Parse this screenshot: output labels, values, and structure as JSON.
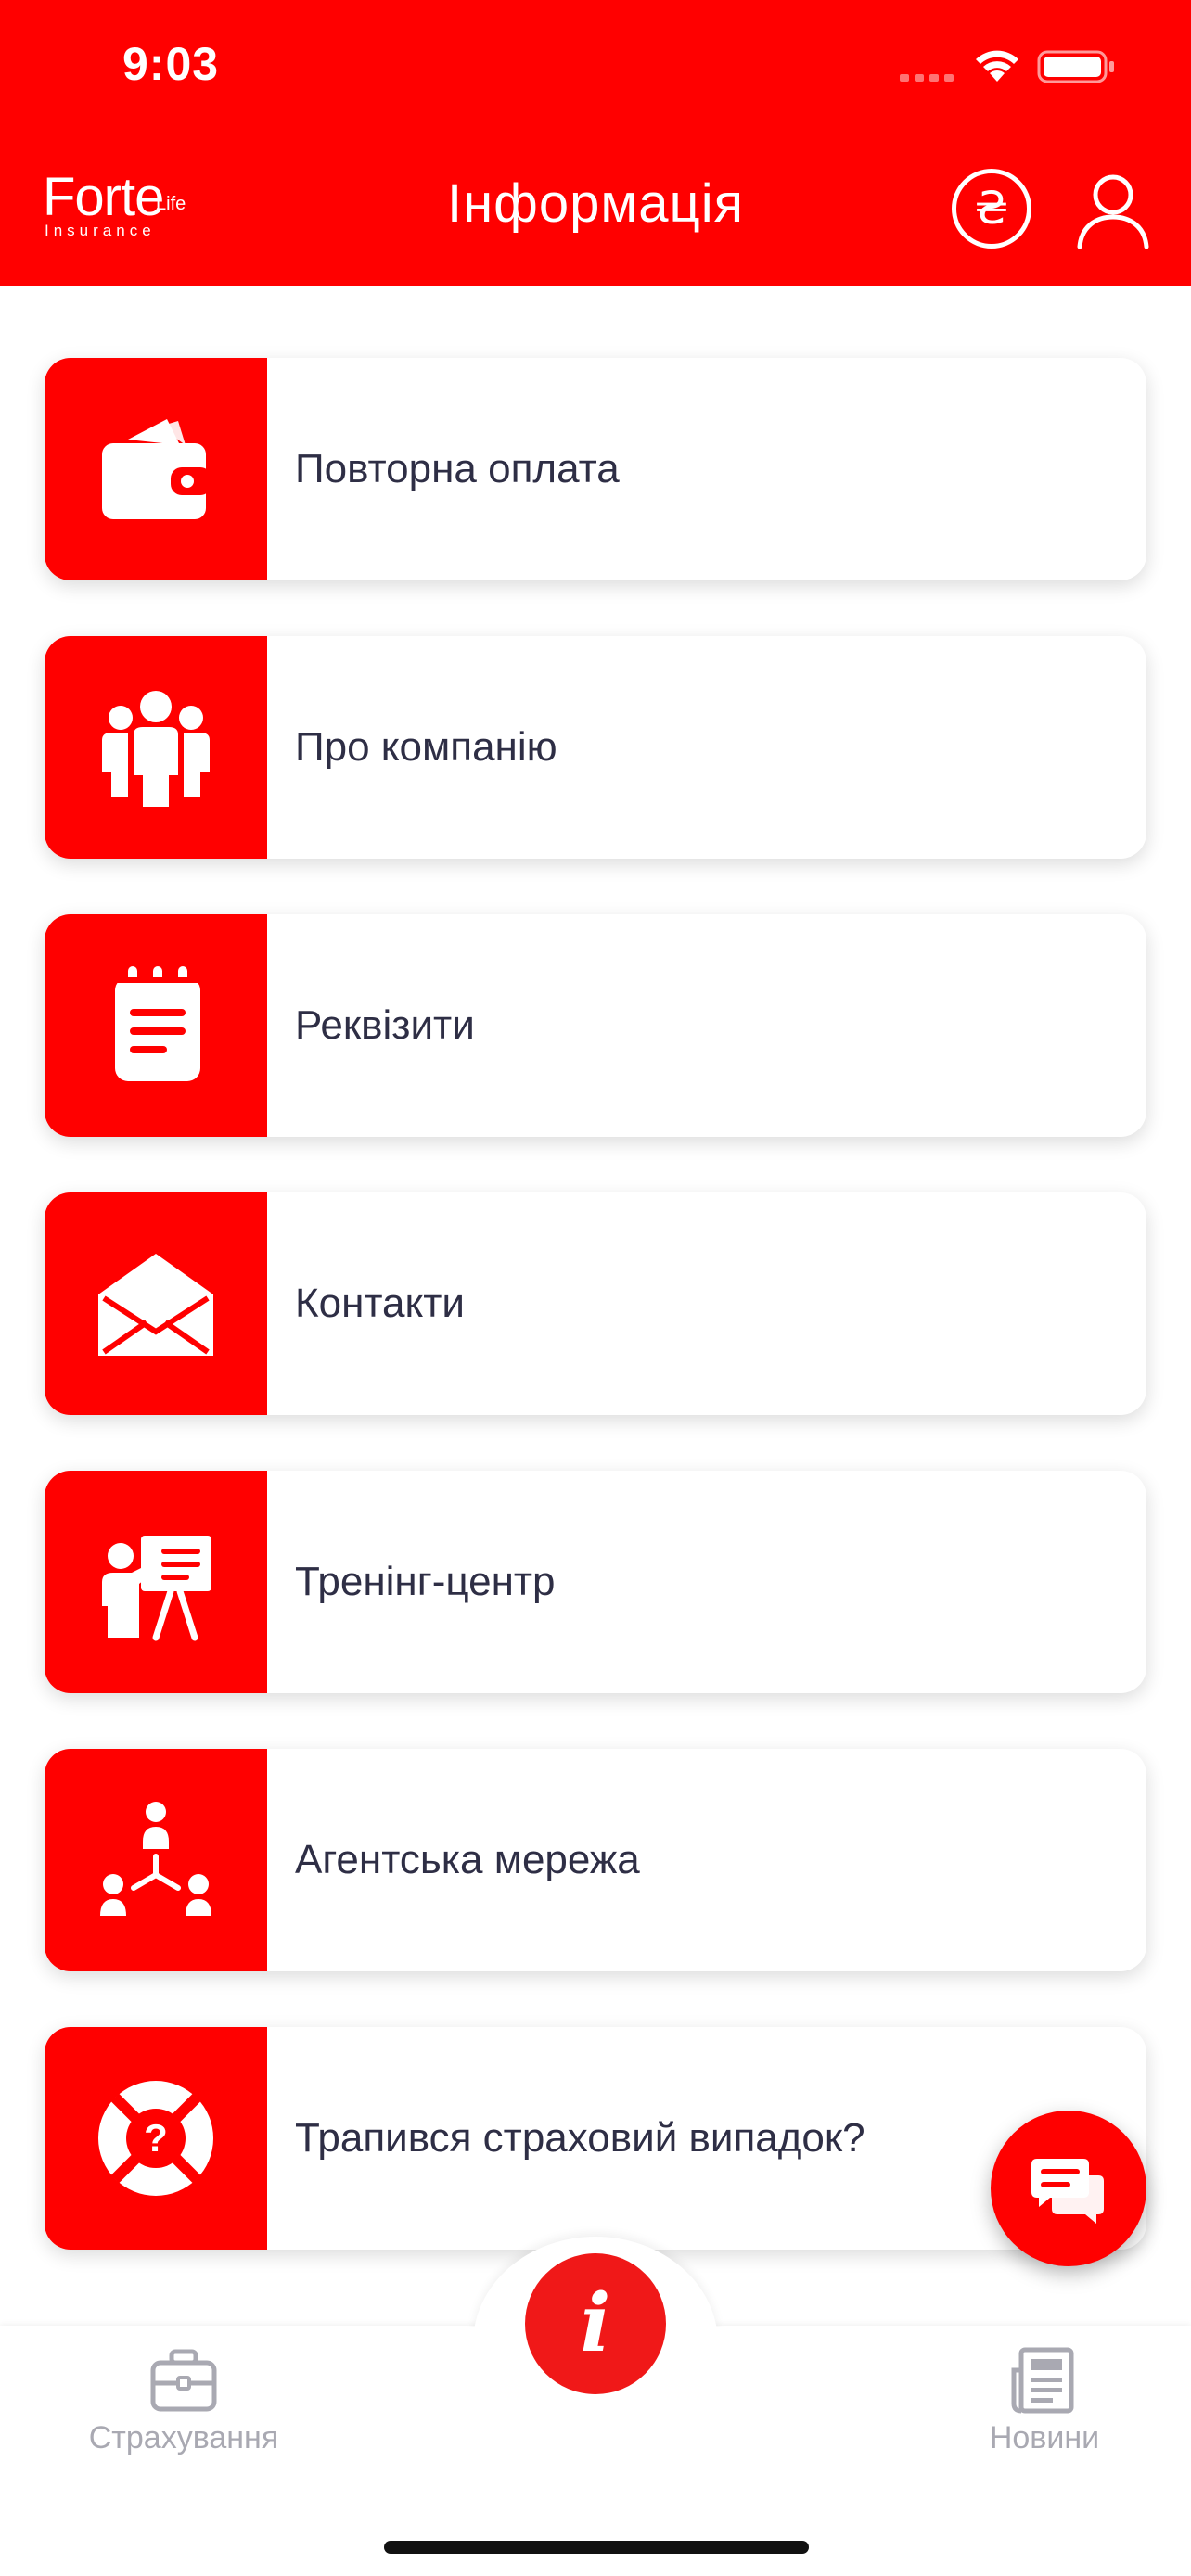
{
  "status_bar": {
    "time": "9:03"
  },
  "header": {
    "logo": {
      "brand": "Forte",
      "brand_suffix": "Life",
      "subtitle": "Insurance"
    },
    "title": "Інформація",
    "currency_symbol": "₴",
    "profile_icon": "user-icon"
  },
  "menu": {
    "items": [
      {
        "label": "Повторна оплата",
        "icon": "wallet-icon"
      },
      {
        "label": "Про компанію",
        "icon": "team-icon"
      },
      {
        "label": "Реквізити",
        "icon": "notepad-icon"
      },
      {
        "label": "Контакти",
        "icon": "envelope-icon"
      },
      {
        "label": "Тренінг-центр",
        "icon": "presentation-icon"
      },
      {
        "label": "Агентська мережа",
        "icon": "network-icon"
      },
      {
        "label": "Трапився страховий випадок?",
        "icon": "lifebuoy-icon"
      }
    ]
  },
  "chat_button": {
    "icon": "chat-icon"
  },
  "tab_bar": {
    "tabs": [
      {
        "label": "Страхування",
        "icon": "briefcase-icon"
      },
      {
        "label": "Новини",
        "icon": "newspaper-icon"
      }
    ],
    "center_icon": "info-icon",
    "center_symbol": "i"
  },
  "colors": {
    "accent": "#ff0000",
    "text": "#2e2e45",
    "tab_inactive": "#a9a9b2"
  }
}
